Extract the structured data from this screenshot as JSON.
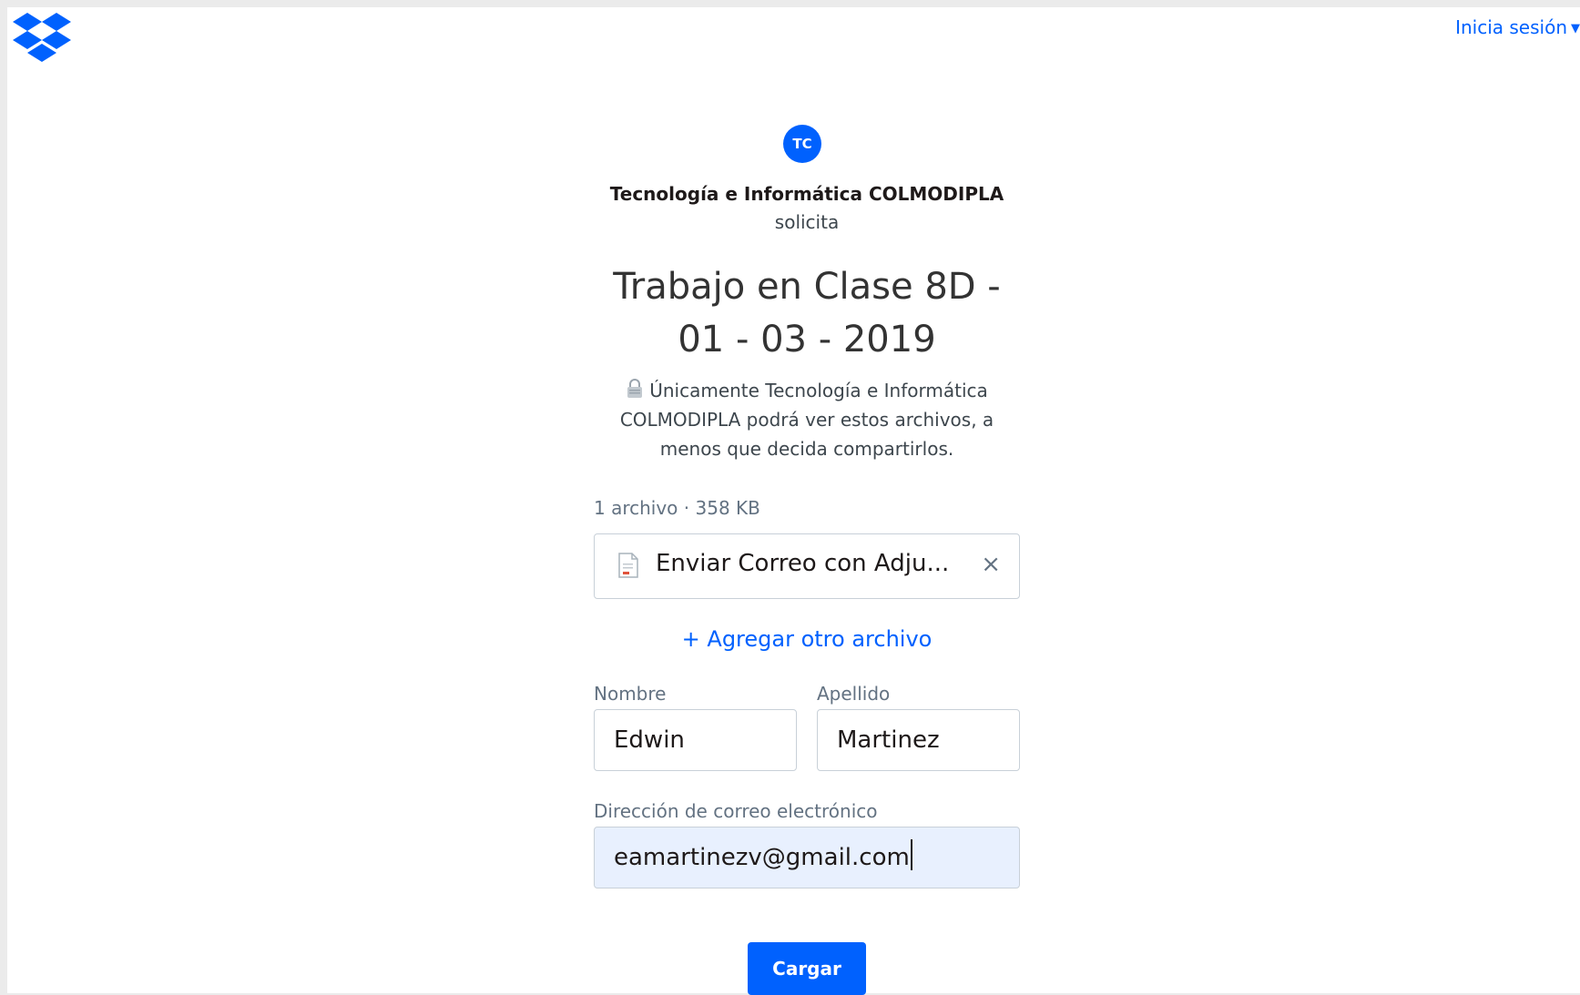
{
  "header": {
    "logo_icon": "dropbox-logo-icon",
    "signin_label": "Inicia sesión",
    "signin_caret": "▼"
  },
  "request": {
    "avatar_initials": "TC",
    "requester_name": "Tecnología e Informática COLMODIPLA",
    "requests_text": "solicita",
    "title_line1": "Trabajo en Clase 8D -",
    "title_line2": "01 - 03 - 2019",
    "privacy_line1": "Únicamente Tecnología e Informática",
    "privacy_line2": "COLMODIPLA podrá ver estos archivos, a",
    "privacy_line3": "menos que decida compartirlos.",
    "privacy_icon": "lock-icon"
  },
  "files": {
    "summary": "1 archivo · 358 KB",
    "items": [
      {
        "name": "Enviar Correo con Adju...",
        "icon": "pdf-file-icon",
        "remove_label": "×"
      }
    ],
    "add_label": "+ Agregar otro archivo"
  },
  "form": {
    "first_name_label": "Nombre",
    "first_name_value": "Edwin",
    "last_name_label": "Apellido",
    "last_name_value": "Martinez",
    "email_label": "Dirección de correo electrónico",
    "email_value": "eamartinezv@gmail.com",
    "submit_label": "Cargar"
  },
  "colors": {
    "accent": "#0061fe",
    "focused_input_bg": "#e8f0fe"
  }
}
